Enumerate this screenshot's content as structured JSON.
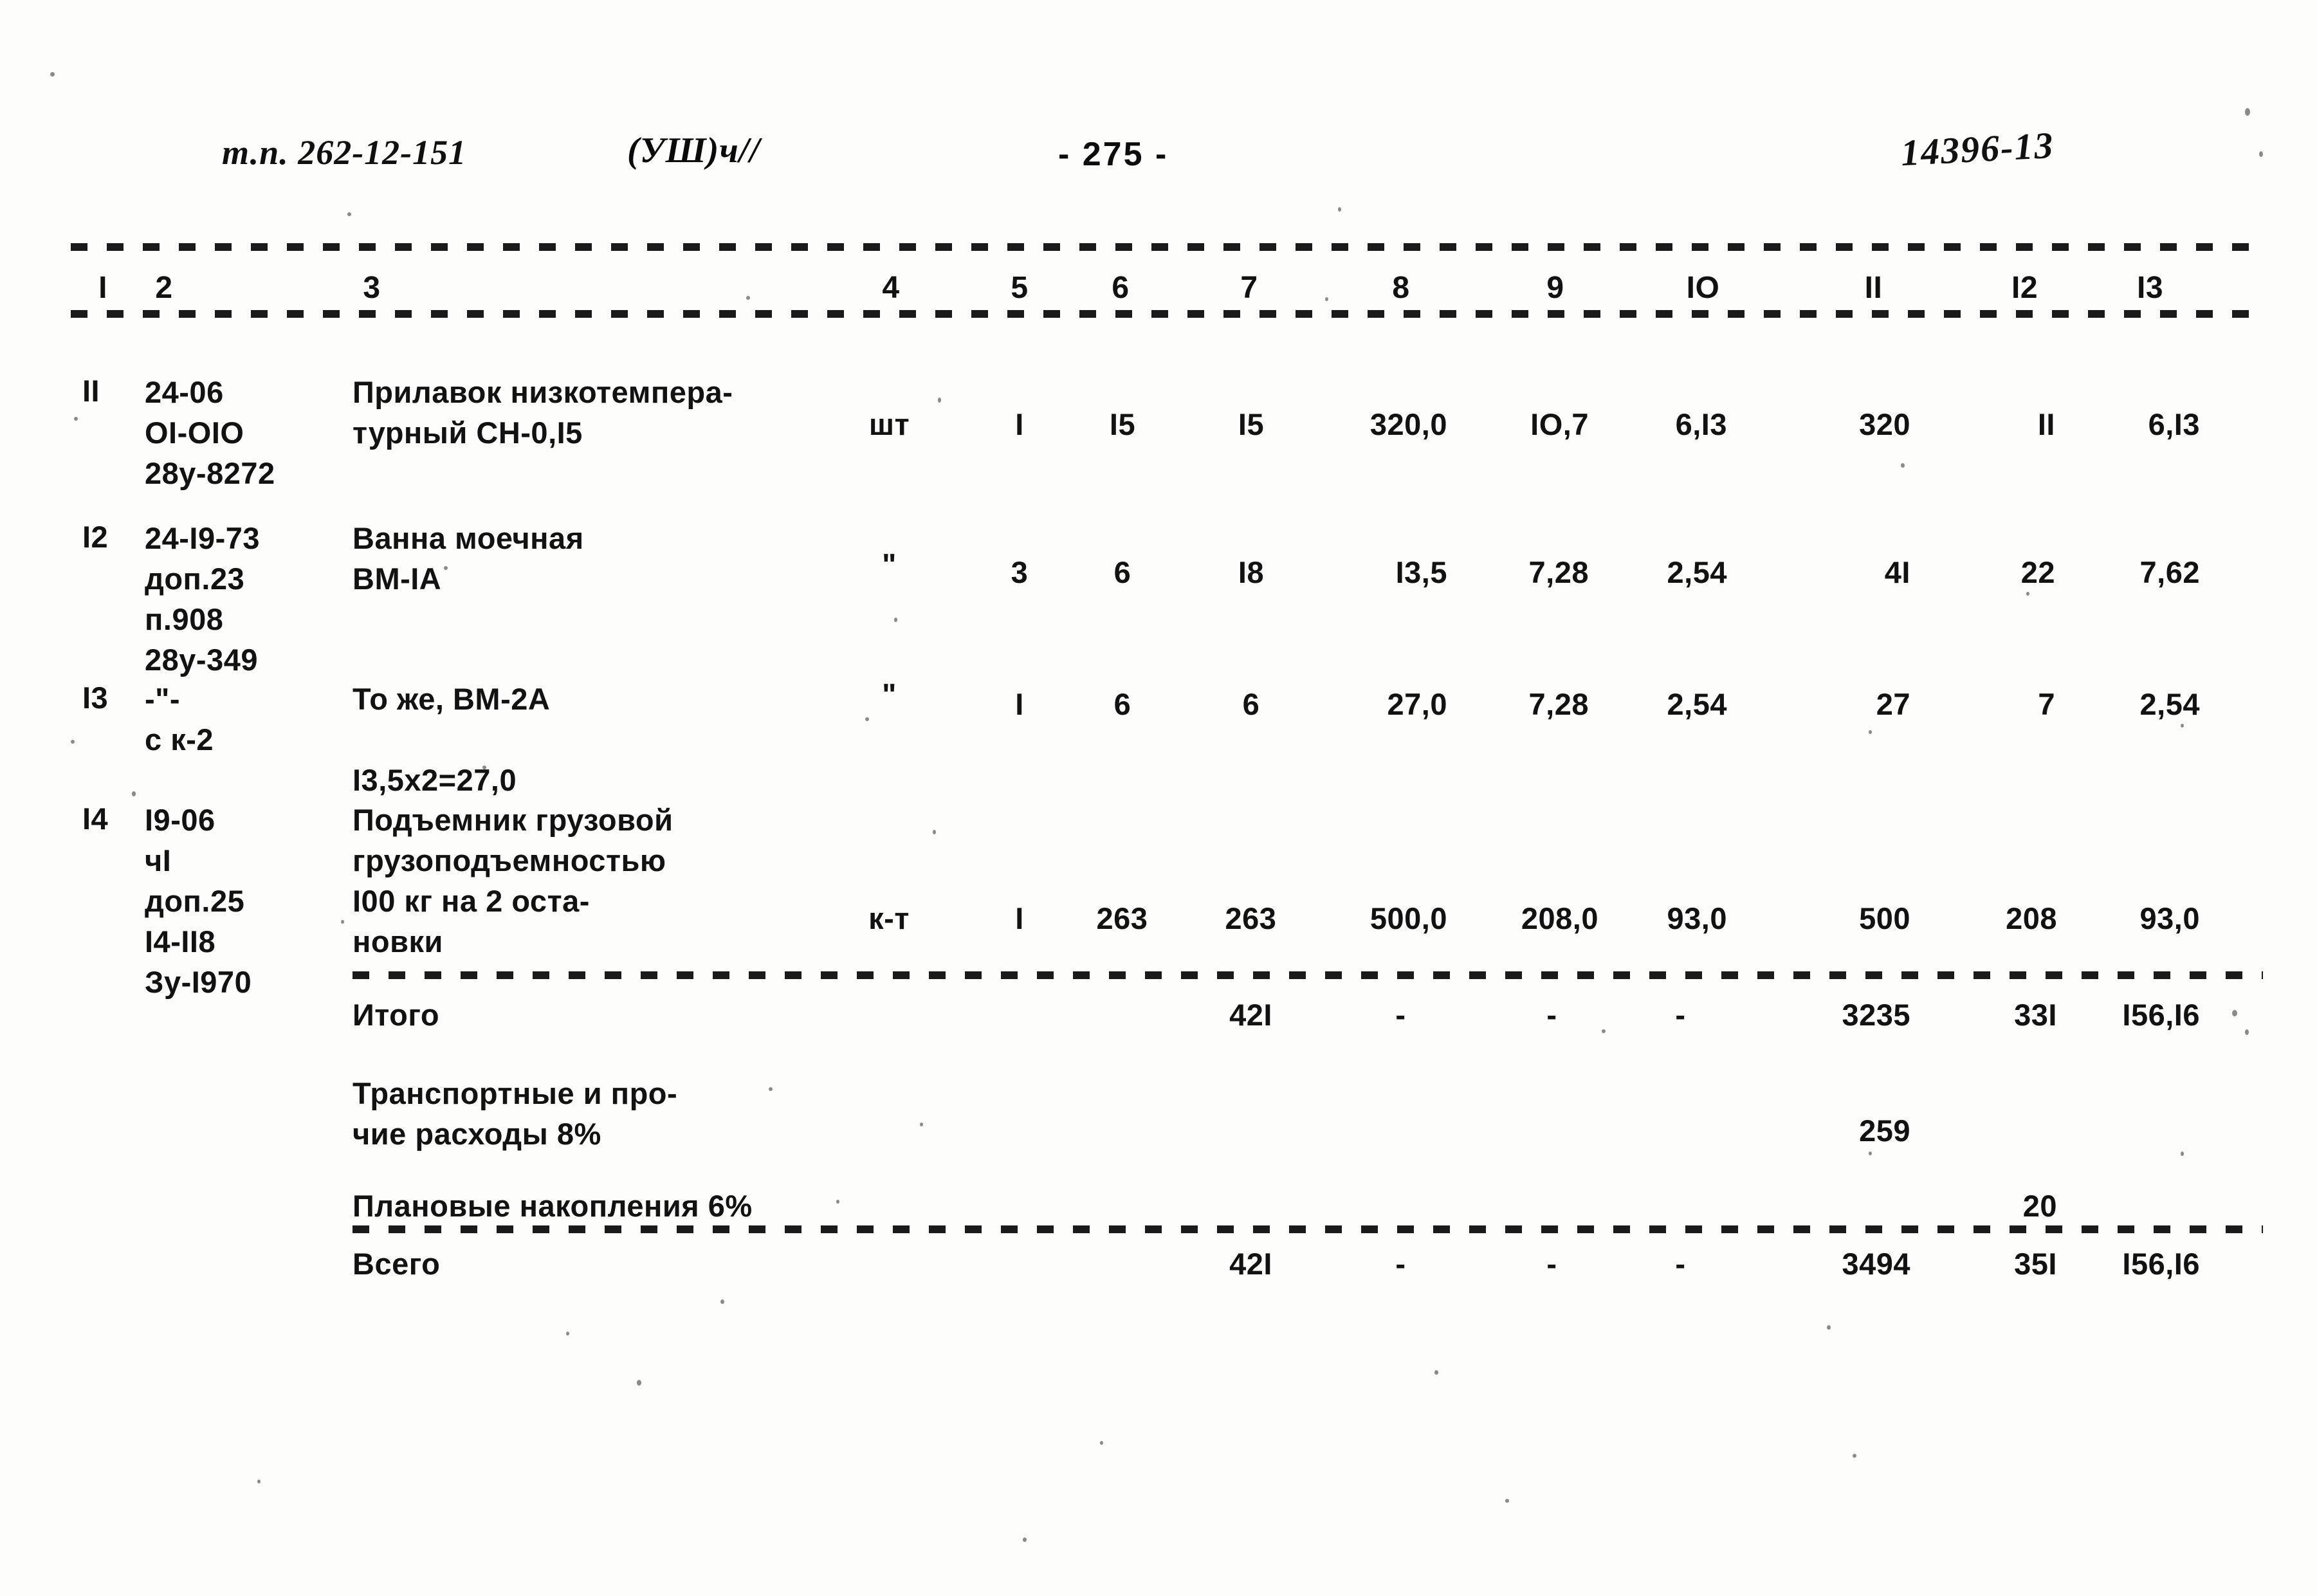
{
  "header": {
    "doc_code": "т.п. 262-12-151",
    "part": "(УШ)ч//",
    "page_number": "- 275 -",
    "stamp": "14396-13"
  },
  "table": {
    "column_headers": [
      "I",
      "2",
      "3",
      "4",
      "5",
      "6",
      "7",
      "8",
      "9",
      "IO",
      "II",
      "I2",
      "I3"
    ],
    "rows": [
      {
        "num": "II",
        "code": "24-06\nOI-OIO\n28у-8272",
        "name": "Прилавок низкотемпера-\nтурный СН-0,I5",
        "unit": "шт",
        "c5": "I",
        "c6": "I5",
        "c7": "I5",
        "c8": "320,0",
        "c9": "IO,7",
        "c10": "6,I3",
        "c11": "320",
        "c12": "II",
        "c13": "6,I3"
      },
      {
        "num": "I2",
        "code": "24-I9-73\nдоп.23\nп.908\n28у-349",
        "name": "Ванна моечная\nВМ-IА",
        "unit": "\"",
        "c5": "3",
        "c6": "6",
        "c7": "I8",
        "c8": "I3,5",
        "c9": "7,28",
        "c10": "2,54",
        "c11": "4I",
        "c12": "22",
        "c13": "7,62"
      },
      {
        "num": "I3",
        "code": "-\"-\nс к-2",
        "name": "То же, ВМ-2А\n\nI3,5х2=27,0",
        "unit": "\"",
        "c5": "I",
        "c6": "6",
        "c7": "6",
        "c8": "27,0",
        "c9": "7,28",
        "c10": "2,54",
        "c11": "27",
        "c12": "7",
        "c13": "2,54"
      },
      {
        "num": "I4",
        "code": "I9-06\nчI\nдоп.25\nI4-II8\nЗу-I970",
        "name": "Подъемник грузовой\nгрузоподъемностью\nI00 кг на 2 оста-\nновки",
        "unit": "к-т",
        "c5": "I",
        "c6": "263",
        "c7": "263",
        "c8": "500,0",
        "c9": "208,0",
        "c10": "93,0",
        "c11": "500",
        "c12": "208",
        "c13": "93,0"
      }
    ],
    "summary": [
      {
        "label": "Итого",
        "c7": "42I",
        "c8": "-",
        "c9": "-",
        "c10": "-",
        "c11": "3235",
        "c12": "33I",
        "c13": "I56,I6"
      },
      {
        "label": "Транспортные и про-\nчие расходы 8%",
        "c7": "",
        "c8": "",
        "c9": "",
        "c10": "",
        "c11": "259",
        "c12": "",
        "c13": ""
      },
      {
        "label": "Плановые накопления 6%",
        "c7": "",
        "c8": "",
        "c9": "",
        "c10": "",
        "c11": "",
        "c12": "20",
        "c13": ""
      },
      {
        "label": "Всего",
        "c7": "42I",
        "c8": "-",
        "c9": "-",
        "c10": "-",
        "c11": "3494",
        "c12": "35I",
        "c13": "I56,I6"
      }
    ]
  }
}
